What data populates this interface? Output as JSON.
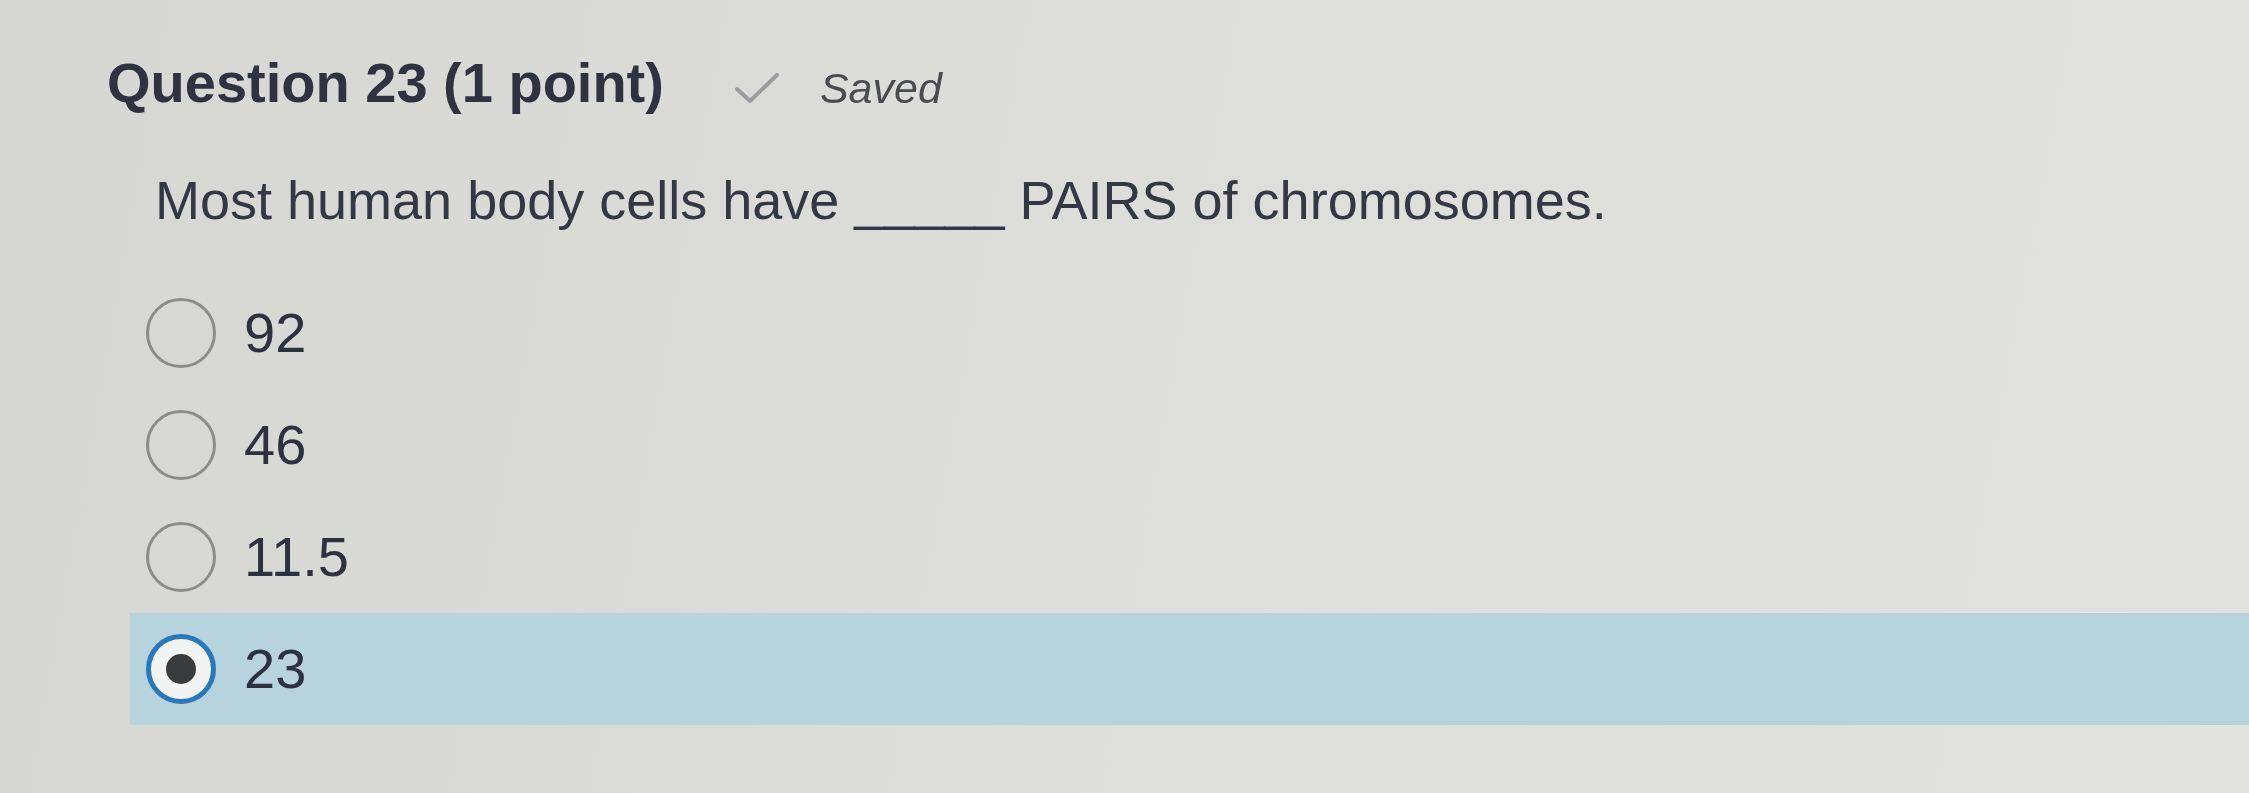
{
  "question": {
    "title": "Question 23 (1 point)",
    "status": {
      "kind": "saved",
      "label": "Saved"
    }
  },
  "prompt": "Most human body cells have _____ PAIRS of chromosomes.",
  "options": [
    {
      "label": "92",
      "selected": false
    },
    {
      "label": "46",
      "selected": false
    },
    {
      "label": "11.5",
      "selected": false
    },
    {
      "label": "23",
      "selected": true
    }
  ]
}
